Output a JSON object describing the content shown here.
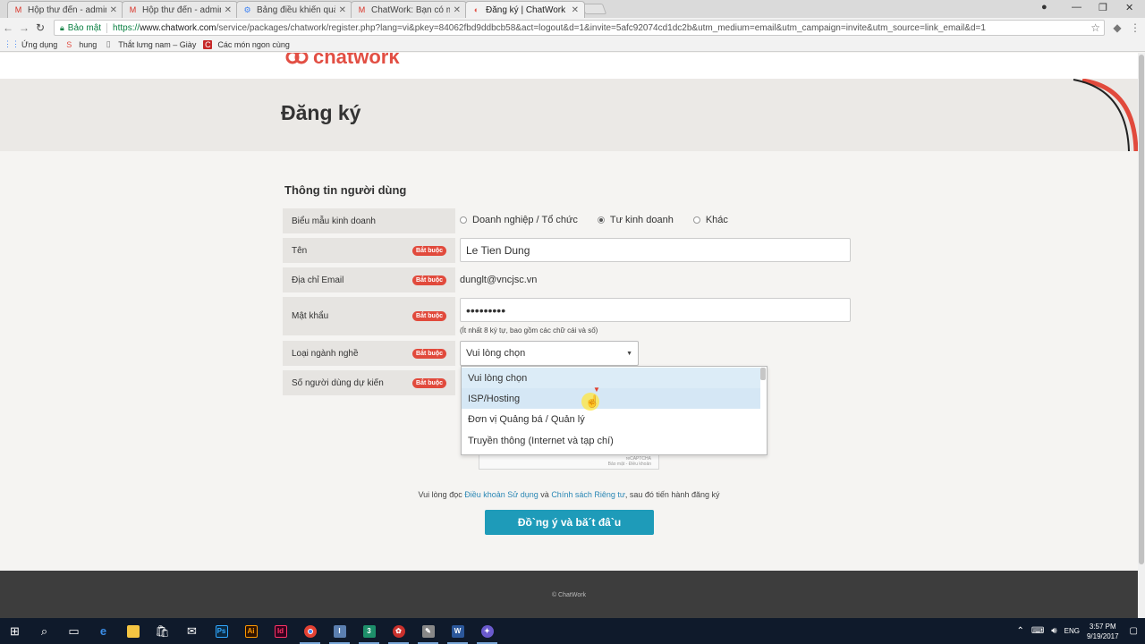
{
  "browser": {
    "tabs": [
      {
        "title": "Hộp thư đến - admin@v",
        "icon": "gmail-icon",
        "active": false
      },
      {
        "title": "Hộp thư đến - admin@v",
        "icon": "gmail-icon",
        "active": false
      },
      {
        "title": "Bảng điều khiển quản trị",
        "icon": "admin-icon",
        "active": false
      },
      {
        "title": "ChatWork: Bạn có một lờ",
        "icon": "gmail-icon",
        "active": false
      },
      {
        "title": "Đăng ký | ChatWork",
        "icon": "chatwork-icon",
        "active": true
      }
    ],
    "secure_label": "Bảo mật",
    "url_prefix": "https://",
    "url_host": "www.chatwork.com",
    "url_path": "/service/packages/chatwork/register.php?lang=vi&pkey=84062fbd9ddbcb58&act=logout&d=1&invite=5afc92074cd1dc2b&utm_medium=email&utm_campaign=invite&utm_source=link_email&d=1",
    "bookmarks": [
      {
        "label": "Ứng dụng",
        "icon": "apps-grid-icon"
      },
      {
        "label": "hung",
        "icon": "bookmark-icon"
      },
      {
        "label": "Thắt lưng nam – Giày",
        "icon": "page-icon"
      },
      {
        "label": "Các món ngon cùng",
        "icon": "cookbook-icon"
      }
    ]
  },
  "page": {
    "logo_text": "chatwork",
    "heading": "Đăng ký",
    "section_title": "Thông tin người dùng",
    "required_badge": "Bắt buộc",
    "fields": {
      "business_type": {
        "label": "Biểu mẫu kinh doanh",
        "options": [
          "Doanh nghiệp / Tổ chức",
          "Tư kinh doanh",
          "Khác"
        ],
        "selected": "Tư kinh doanh"
      },
      "name": {
        "label": "Tên",
        "value": "Le Tien Dung"
      },
      "email": {
        "label": "Địa chỉ Email",
        "value": "dunglt@vncjsc.vn"
      },
      "password": {
        "label": "Mật khẩu",
        "value": "•••••••••",
        "hint": "(Ít nhất 8 ký tự, bao gồm các chữ cái và số)"
      },
      "industry": {
        "label": "Loại ngành nghề",
        "value": "Vui lòng chọn",
        "options": [
          "Vui lòng chọn",
          "ISP/Hosting",
          "Đơn vị Quảng bá / Quản lý",
          "Truyền thông (Internet và tạp chí)"
        ]
      },
      "users": {
        "label": "Số người dùng dự kiến"
      }
    },
    "captcha_text": "Bảo mật - Điều khoản",
    "agree": {
      "before": "Vui lòng đọc ",
      "terms": "Điều khoản Sử dụng",
      "middle": " và ",
      "privacy": "Chính sách Riêng tư",
      "after": ", sau đó tiến hành đăng ký"
    },
    "submit_label": "Đồ`ng ý và bă´t đâ`u",
    "footer": "© ChatWork"
  },
  "taskbar": {
    "language": "ENG",
    "time": "3:57 PM",
    "date": "9/19/2017",
    "apps": [
      "windows-icon",
      "search-icon",
      "task-view-icon",
      "edge-icon",
      "file-explorer-icon",
      "store-icon",
      "mail-icon",
      "photoshop-icon",
      "illustrator-icon",
      "indesign-icon",
      "chrome-icon",
      "app-icon",
      "app-icon",
      "app-icon",
      "app-icon",
      "word-icon",
      "app-icon"
    ]
  },
  "colors": {
    "accent_red": "#e14a3c",
    "cta_blue": "#1e9bb9",
    "link_blue": "#2b87b5",
    "footer_bg": "#3d3d3d"
  }
}
